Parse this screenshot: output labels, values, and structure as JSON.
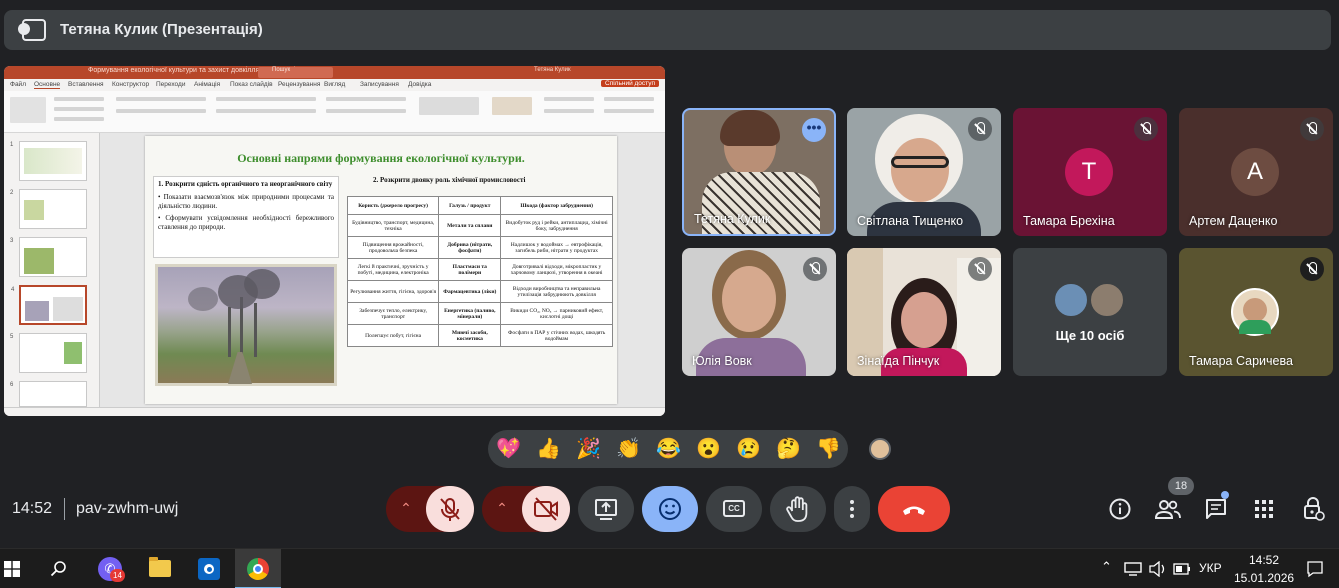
{
  "header": {
    "title": "Тетяна Кулик (Презентація)"
  },
  "presentation": {
    "window_title": "Формування екологічної культури та захист довкілля - PowerPoint",
    "search_placeholder": "Пошук",
    "user": "Тетяна Кулик",
    "tabs": [
      "Файл",
      "Основне",
      "Вставлення",
      "Конструктор",
      "Переходи",
      "Анімація",
      "Показ слайдів",
      "Рецензування",
      "Вигляд",
      "Записування",
      "Довідка"
    ],
    "share_label": "Спільний доступ",
    "slide_numbers": [
      "1",
      "2",
      "3",
      "4",
      "5",
      "6"
    ],
    "slide_title": "Основні напрями формування екологічної культури.",
    "left_heading": "1. Розкрити єдність органічного та неорганічного світу",
    "left_bullets": [
      "• Показати взаємозв'язок між природними процесами та діяльністю людини.",
      "• Сформувати усвідомлення необхідності бережливого ставлення до природи."
    ],
    "right_heading": "2. Розкрити двояку роль хімічної промисловості",
    "table": {
      "headers": [
        "Користь (джерело прогресу)",
        "Галузь / продукт",
        "Шкода (фактор забруднення)"
      ],
      "rows": [
        [
          "Будівництво, транспорт, медицина, техніка",
          "Метали та сплави",
          "Видобуток руд і рейки, антиплацид, хімічні боку, забруднення"
        ],
        [
          "Підвищення врожайності, продовольча безпека",
          "Добрива (нітрати, фосфати)",
          "Надлишок у водоймах → евтрофікація, загибель риби, нітрати у продуктах"
        ],
        [
          "Легкі й практичні, зручність у побуті, медицина, електроніка",
          "Пластмаси та полімери",
          "Довготривалі відходи, мікропластик у харчовому ланцюзі, утворення в океані"
        ],
        [
          "Регулювання життя, гігієна, здоров'я",
          "Фармацевтика (ліки)",
          "Відходи виробництва та неправильна утилізація забруднюють довкілля"
        ],
        [
          "Забезпечує тепло, електрику, транспорт",
          "Енергетика (паливо, мінерали)",
          "Викиди CO₂, NOₓ → парниковий ефект, кислотні дощі"
        ],
        [
          "Полегшує побут, гігієна",
          "Миючі засоби, косметика",
          "Фосфати в ПАР у стічних водах, шкодять водоймам"
        ]
      ]
    }
  },
  "participants": [
    {
      "name": "Тетяна Кулик",
      "muted": false,
      "speaking": true
    },
    {
      "name": "Світлана Тищенко",
      "muted": true
    },
    {
      "name": "Тамара Брехіна",
      "initial": "Т",
      "color": "#b0154a",
      "muted": true
    },
    {
      "name": "Артем Даценко",
      "initial": "А",
      "color": "#6a4a48",
      "muted": true
    },
    {
      "name": "Юлія Вовк",
      "muted": true
    },
    {
      "name": "Зінаїда Пінчук",
      "muted": true
    },
    {
      "name": "Ще 10 осіб"
    },
    {
      "name": "Тамара Саричева",
      "muted": true
    }
  ],
  "reactions": [
    "💖",
    "👍",
    "🎉",
    "👏",
    "😂",
    "😮",
    "😢",
    "🤔",
    "👎"
  ],
  "meeting": {
    "time": "14:52",
    "code": "pav-zwhm-uwj",
    "people_count": "18"
  },
  "controls": {
    "mic_icon": "mic-off-icon",
    "cam_icon": "camera-off-icon",
    "present_icon": "present-screen-icon",
    "emoji_icon": "emoji-icon",
    "captions_label": "CC",
    "hand_icon": "raise-hand-icon",
    "more_icon": "more-vert-icon",
    "leave_icon": "call-end-icon"
  },
  "colors": {
    "leave": "#ea4335",
    "mic_off_bg": "#f9dedc",
    "mic_off_fg": "#8c1d18",
    "emoji_active": "#8ab4f8",
    "ppt_accent": "#b7472a"
  },
  "taskbar": {
    "time": "14:52",
    "date": "15.01.2026",
    "lang": "УКР",
    "viber_badge": "14"
  }
}
